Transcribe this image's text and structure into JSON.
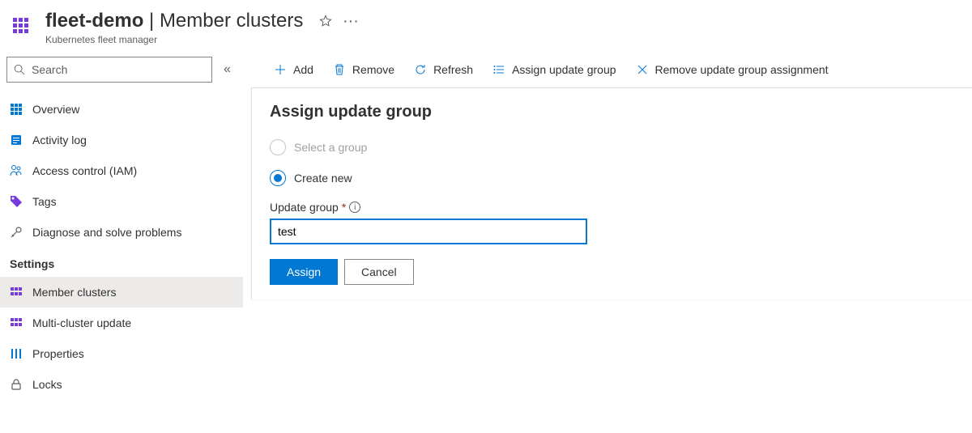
{
  "header": {
    "resource_name": "fleet-demo",
    "separator": "|",
    "page_name": "Member clusters",
    "subtitle": "Kubernetes fleet manager"
  },
  "search": {
    "placeholder": "Search"
  },
  "nav": {
    "items_top": [
      {
        "label": "Overview",
        "icon": "overview-icon"
      },
      {
        "label": "Activity log",
        "icon": "activity-log-icon"
      },
      {
        "label": "Access control (IAM)",
        "icon": "access-control-icon"
      },
      {
        "label": "Tags",
        "icon": "tags-icon"
      },
      {
        "label": "Diagnose and solve problems",
        "icon": "diagnose-icon"
      }
    ],
    "section_settings": "Settings",
    "items_settings": [
      {
        "label": "Member clusters",
        "active": true
      },
      {
        "label": "Multi-cluster update"
      },
      {
        "label": "Properties"
      },
      {
        "label": "Locks"
      }
    ]
  },
  "toolbar": {
    "add": "Add",
    "remove": "Remove",
    "refresh": "Refresh",
    "assign_group": "Assign update group",
    "remove_assignment": "Remove update group assignment"
  },
  "panel": {
    "title": "Assign update group",
    "radio_select": "Select a group",
    "radio_create": "Create new",
    "field_label": "Update group",
    "input_value": "test",
    "assign_btn": "Assign",
    "cancel_btn": "Cancel"
  }
}
